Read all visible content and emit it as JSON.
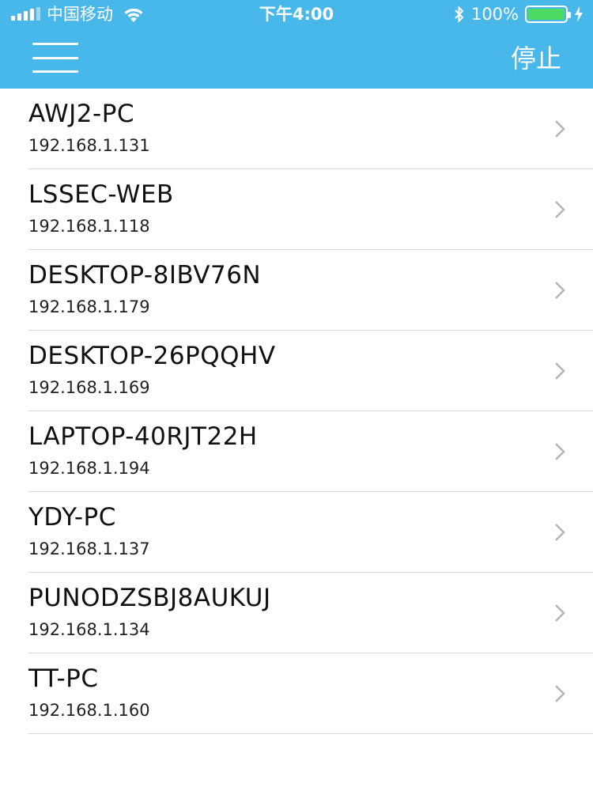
{
  "status_bar": {
    "carrier": "中国移动",
    "time": "下午4:00",
    "battery": "100%",
    "battery_level": 1.0,
    "battery_color": "#4cd964"
  },
  "nav": {
    "menu_icon": "hamburger-menu-icon",
    "stop_label": "停止",
    "bar_color": "#48b8ea"
  },
  "devices": [
    {
      "name": "AWJ2-PC",
      "ip": "192.168.1.131"
    },
    {
      "name": "LSSEC-WEB",
      "ip": "192.168.1.118"
    },
    {
      "name": "DESKTOP-8IBV76N",
      "ip": "192.168.1.179"
    },
    {
      "name": "DESKTOP-26PQQHV",
      "ip": "192.168.1.169"
    },
    {
      "name": "LAPTOP-40RJT22H",
      "ip": "192.168.1.194"
    },
    {
      "name": "YDY-PC",
      "ip": "192.168.1.137"
    },
    {
      "name": "PUNODZSBJ8AUKUJ",
      "ip": "192.168.1.134"
    },
    {
      "name": "TT-PC",
      "ip": "192.168.1.160"
    }
  ]
}
